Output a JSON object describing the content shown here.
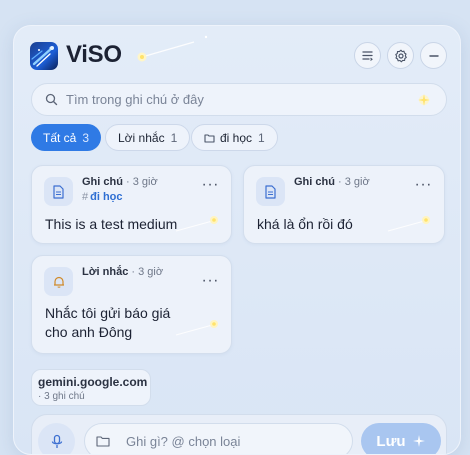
{
  "header": {
    "app_name": "ViSO",
    "buttons": [
      {
        "icon": "list-icon"
      },
      {
        "icon": "gear-icon"
      },
      {
        "icon": "minimize-icon"
      }
    ]
  },
  "search": {
    "placeholder": "Tìm trong ghi chú ở đây",
    "value": ""
  },
  "filters": [
    {
      "label": "Tất cả",
      "count": "3",
      "active": true
    },
    {
      "label": "Lời nhắc",
      "count": "1",
      "active": false
    },
    {
      "label": "đi học",
      "count": "1",
      "active": false,
      "icon": "folder-icon"
    }
  ],
  "notes": [
    {
      "kind": "Ghi chú",
      "time": "3 giờ",
      "tag": "đi học",
      "icon": "document-icon",
      "text_lines": [
        "This is a test medium"
      ]
    },
    {
      "kind": "Ghi chú",
      "time": "3 giờ",
      "tag": "",
      "icon": "document-icon",
      "text_lines": [
        "khá là ổn rồi đó"
      ]
    },
    {
      "kind": "Lời nhắc",
      "time": "3 giờ",
      "tag": "",
      "icon": "bell-icon",
      "text_lines": [
        "Nhắc tôi gửi báo giá",
        "cho anh Đông"
      ]
    }
  ],
  "meta_separator": "·",
  "more_label": "···",
  "source": {
    "domain": "gemini.google.com",
    "sub": "· 3 ghi chú"
  },
  "composer": {
    "placeholder": "Ghi gì? @ chọn loại",
    "save_label": "Lưu"
  },
  "colors": {
    "accent": "#2f7ae5",
    "tag": "#2f6fd3",
    "reminder_icon": "#d08a2a",
    "note_icon": "#3c6fd1",
    "save_disabled": "#a9c6f0"
  }
}
